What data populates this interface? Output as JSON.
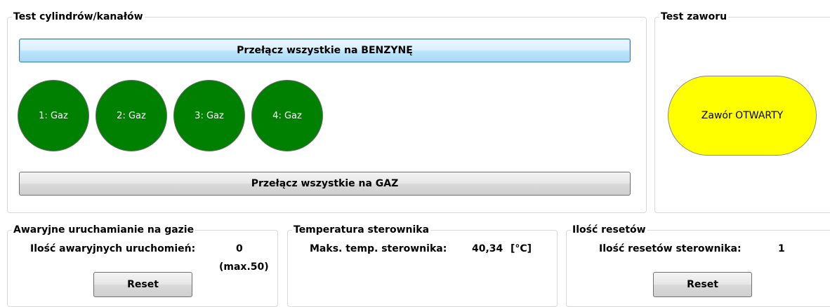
{
  "cylinder_test": {
    "title": "Test cylindrów/kanałów",
    "btn_all_petrol": "Przełącz wszystkie na BENZYNĘ",
    "btn_all_gas": "Przełącz wszystkie na GAZ",
    "cylinders": [
      {
        "label": "1: Gaz",
        "color": "#008000"
      },
      {
        "label": "2: Gaz",
        "color": "#008000"
      },
      {
        "label": "3: Gaz",
        "color": "#008000"
      },
      {
        "label": "4: Gaz",
        "color": "#008000"
      }
    ]
  },
  "valve_test": {
    "title": "Test zaworu",
    "state_label": "Zawór OTWARTY",
    "state_color": "#ffff00"
  },
  "emergency_start": {
    "title": "Awaryjne uruchamianie na gazie",
    "count_label": "Ilość awaryjnych uruchomień:",
    "count_value": "0",
    "max_note": "(max.50)",
    "reset_label": "Reset"
  },
  "controller_temp": {
    "title": "Temperatura sterownika",
    "max_label": "Maks. temp. sterownika:",
    "max_value": "40,34",
    "unit": "[°C]"
  },
  "resets": {
    "title": "Ilość resetów",
    "count_label": "Ilość resetów sterownika:",
    "count_value": "1",
    "reset_label": "Reset"
  }
}
